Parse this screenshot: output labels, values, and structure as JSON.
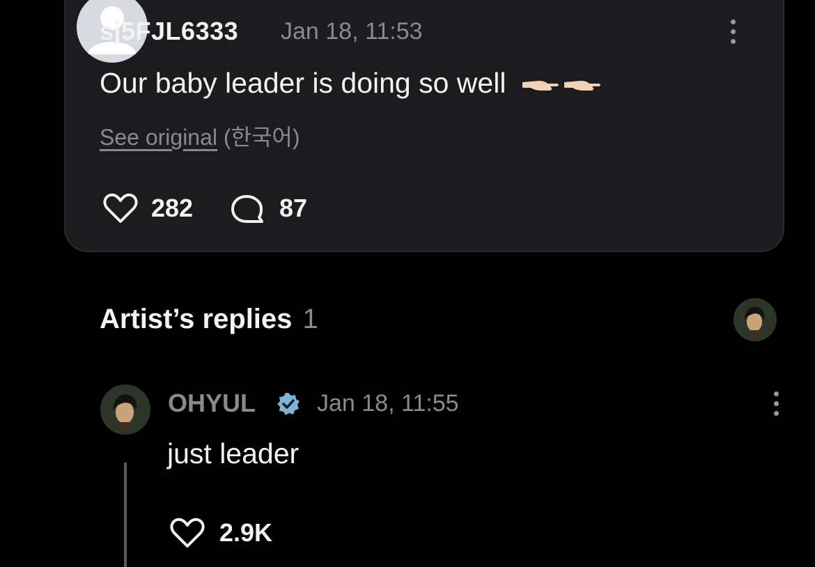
{
  "comment": {
    "username": "sj5FJL6333",
    "timestamp": "Jan 18, 11:53",
    "text": "Our baby leader is doing so well",
    "emoji_icon": "pointing-hands-icon",
    "see_original_link": "See original",
    "see_original_lang": "(한국어)",
    "likes": "282",
    "replies": "87"
  },
  "artist_section": {
    "title": "Artist’s replies",
    "count": "1"
  },
  "artist_reply": {
    "name": "OHYUL",
    "timestamp": "Jan 18, 11:55",
    "text": "just leader",
    "likes": "2.9K"
  },
  "colors": {
    "background": "#000000",
    "card": "#1c1c1e",
    "muted_text": "#8a8a8e",
    "verified_badge": "#7fb3d5"
  }
}
